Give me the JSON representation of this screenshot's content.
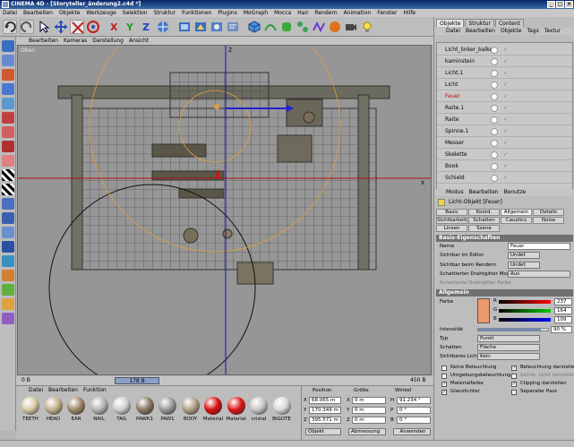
{
  "window": {
    "title": "CINEMA 4D - [Storyteller_änderung2.c4d *]"
  },
  "menubar": [
    "Datei",
    "Bearbeiten",
    "Objekte",
    "Werkzeuge",
    "Selektion",
    "Struktur",
    "Funktionen",
    "Plugins",
    "MoGraph",
    "Mocca",
    "Hair",
    "Rendern",
    "Animation",
    "Fenster",
    "Hilfe"
  ],
  "viewport": {
    "menu": [
      "Bearbeiten",
      "Kameras",
      "Darstellung",
      "Ansicht"
    ],
    "view_label": "Oben",
    "status_left": "0 B",
    "status_mid": "178 B",
    "status_right": "450 B"
  },
  "materials": {
    "menu": [
      "Datei",
      "Bearbeiten",
      "Funktion"
    ],
    "items": [
      {
        "label": "TEETH",
        "color": "#d9cba6"
      },
      {
        "label": "HEAD",
        "color": "#c4b08e"
      },
      {
        "label": "EAR",
        "color": "#a08868"
      },
      {
        "label": "NAIL",
        "color": "#b6b6b6"
      },
      {
        "label": "TAIL",
        "color": "#d0d0d0"
      },
      {
        "label": "PAWK1",
        "color": "#8a7a64"
      },
      {
        "label": "PAW1",
        "color": "#9a9a9a"
      },
      {
        "label": "BODY",
        "color": "#b0a088"
      },
      {
        "label": "Material",
        "color": "#d81010"
      },
      {
        "label": "Material",
        "color": "#e01818"
      },
      {
        "label": "cristal",
        "color": "#c8c8c8"
      },
      {
        "label": "BIGOTE",
        "color": "#d8d8d8"
      }
    ]
  },
  "coords": {
    "headers": [
      "Position",
      "Größe",
      "Winkel"
    ],
    "pos": [
      {
        "axis": "X",
        "value": "68.065 m"
      },
      {
        "axis": "Y",
        "value": "170.349 m"
      },
      {
        "axis": "Z",
        "value": "395.571 m"
      }
    ],
    "size": [
      {
        "axis": "X",
        "value": "0 m"
      },
      {
        "axis": "Y",
        "value": "0 m"
      },
      {
        "axis": "Z",
        "value": "0 m"
      }
    ],
    "rot": [
      {
        "axis": "H",
        "value": "91.234 °"
      },
      {
        "axis": "P",
        "value": "0 °"
      },
      {
        "axis": "B",
        "value": "0 °"
      }
    ],
    "mode": "Objekt",
    "size_mode": "Abmessung",
    "apply": "Anwenden"
  },
  "right": {
    "tabs": [
      "Objekte",
      "Struktur",
      "Content"
    ],
    "obj_menu": [
      "Datei",
      "Bearbeiten",
      "Objekte",
      "Tags",
      "Textur"
    ],
    "objects": [
      {
        "name": "Licht_linker_balken",
        "color": "#000"
      },
      {
        "name": "kaminstein",
        "color": "#000"
      },
      {
        "name": "Licht.1",
        "color": "#000"
      },
      {
        "name": "Licht",
        "color": "#000"
      },
      {
        "name": "Feuer",
        "color": "#d00000"
      },
      {
        "name": "Raite.1",
        "color": "#000"
      },
      {
        "name": "Raite",
        "color": "#000"
      },
      {
        "name": "Spinne.1",
        "color": "#000"
      },
      {
        "name": "Messer",
        "color": "#000"
      },
      {
        "name": "Skelette",
        "color": "#000"
      },
      {
        "name": "Book",
        "color": "#000"
      },
      {
        "name": "Schield",
        "color": "#000"
      }
    ],
    "attr_menu": [
      "Modus",
      "Bearbeiten",
      "Benutze"
    ],
    "attr_title": "Licht-Objekt [Feuer]",
    "attr_tabs_row1": [
      "Basic",
      "Koord.",
      "Allgemein",
      "Details"
    ],
    "attr_tabs_row2": [
      "Sichtbarkeit",
      "Schatten",
      "Caustics",
      "Noise"
    ],
    "attr_tabs_row3": [
      "Linsen",
      "Szene"
    ],
    "basic": {
      "header": "Basis-Eigenschaften",
      "name_label": "Name",
      "name_value": "Feuer",
      "editor_label": "Sichtbar im Editor",
      "editor_value": "Undef.",
      "render_label": "Sichtbar beim Rendern",
      "render_value": "Undef.",
      "wire_label": "Schattierter Drahtgitter Modus",
      "wire_value": "Aus",
      "wirecolor_label": "Schattierte Drahtgitter Farbe"
    },
    "general": {
      "header": "Allgemein",
      "color_label": "Farbe",
      "color_swatch": "#ed9a6d",
      "r_label": "R",
      "r_value": "237",
      "g_label": "G",
      "g_value": "164",
      "b_label": "B",
      "b_value": "109",
      "intensity_label": "Intensität",
      "intensity_value": "90 %",
      "intensity_level": 0.9,
      "type_label": "Typ",
      "type_value": "Punkt",
      "shadow_label": "Schatten",
      "shadow_value": "Fläche",
      "visible_label": "Sichtbares Licht",
      "visible_value": "Kein",
      "checks": [
        {
          "label": "Keine Beleuchtung",
          "checked": false
        },
        {
          "label": "Beleuchtung darstellen",
          "checked": true
        },
        {
          "label": "Umgebungsbeleuchtung",
          "checked": false
        },
        {
          "label": "Sichtb. Licht darstellen",
          "checked": false
        },
        {
          "label": "Materialfarbe",
          "checked": true
        },
        {
          "label": "Clipping darstellen",
          "checked": true
        },
        {
          "label": "Glanzlichter",
          "checked": true
        },
        {
          "label": "Separater Pass",
          "checked": false
        }
      ]
    }
  }
}
